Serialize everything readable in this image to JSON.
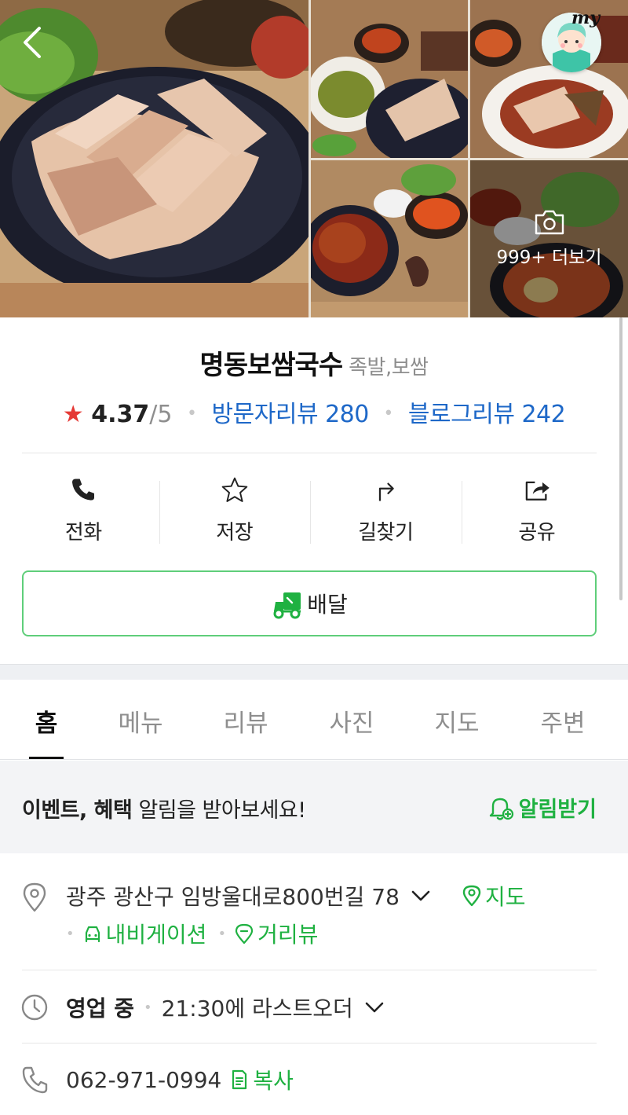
{
  "header": {
    "back_icon": "chevron-left-icon",
    "my_badge": "my",
    "photo_more_label": "999+ 더보기",
    "camera_icon": "camera-icon"
  },
  "place": {
    "name": "명동보쌈국수",
    "category": "족발,보쌈",
    "rating_star": "★",
    "rating": "4.37",
    "rating_max": "/5",
    "visitor_reviews": "방문자리뷰 280",
    "blog_reviews": "블로그리뷰 242"
  },
  "actions": [
    {
      "label": "전화",
      "icon": "phone-icon"
    },
    {
      "label": "저장",
      "icon": "star-outline-icon"
    },
    {
      "label": "길찾기",
      "icon": "directions-icon"
    },
    {
      "label": "공유",
      "icon": "share-icon"
    }
  ],
  "delivery": {
    "label": "배달",
    "icon": "delivery-scooter-icon"
  },
  "tabs": [
    {
      "label": "홈",
      "active": true
    },
    {
      "label": "메뉴"
    },
    {
      "label": "리뷰"
    },
    {
      "label": "사진"
    },
    {
      "label": "지도"
    },
    {
      "label": "주변"
    }
  ],
  "alert": {
    "bold": "이벤트, 혜택",
    "text": " 알림을 받아보세요!",
    "button": "알림받기"
  },
  "address": {
    "text": "광주 광산구 임방울대로800번길 78",
    "map_link": "지도",
    "navigation_link": "내비게이션",
    "street_view_link": "거리뷰"
  },
  "hours": {
    "status": "영업 중",
    "last_order": "21:30에 라스트오더"
  },
  "phone": {
    "number": "062-971-0994",
    "copy_label": "복사"
  },
  "colors": {
    "accent_green": "#1fb141",
    "link_blue": "#1e68c8",
    "star_red": "#e53935"
  }
}
